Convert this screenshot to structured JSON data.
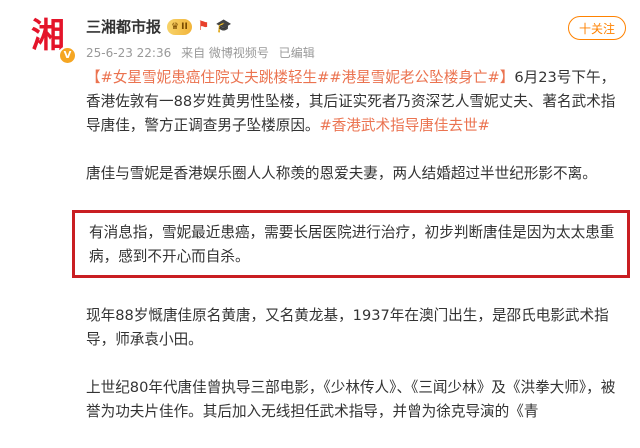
{
  "user": {
    "avatar_logo": "湘",
    "verified_icon": "v-verified-icon",
    "name": "三湘都市报",
    "vip_badge": "II",
    "badge_icons": [
      "flag-badge-icon",
      "graduation-cap-icon"
    ],
    "follow_label": "十关注"
  },
  "meta": {
    "timestamp": "25-6-23 22:36",
    "source": "来自 微博视频号",
    "edited": "已编辑"
  },
  "post": {
    "para1": {
      "tag1": "【#女星雪妮患癌住院丈夫跳楼轻生##港星雪妮老公坠楼身亡#】",
      "text1": "6月23号下午，香港佐敦有一88岁姓黄男性坠楼，其后证实死者乃资深艺人雪妮丈夫、著名武术指导唐佳，警方正调查男子坠楼原因。",
      "tag2": "#香港武术指导唐佳去世#"
    },
    "para2": "唐佳与雪妮是香港娱乐圈人人称羡的恩爱夫妻，两人结婚超过半世纪形影不离。",
    "para3": "有消息指，雪妮最近患癌，需要长居医院进行治疗，初步判断唐佳是因为太太患重病，感到不开心而自杀。",
    "para4": "现年88岁慨唐佳原名黄唐，又名黄龙基，1937年在澳门出生，是邵氏电影武术指导，师承袁小田。",
    "para5": "上世纪80年代唐佳曾执导三部电影，《少林传人》、《三闻少林》及《洪拳大师》，被誉为功夫片佳作。其后加入无线担任武术指导，并曾为徐克导演的《青"
  },
  "colors": {
    "accent": "#ff8200",
    "tag": "#eb7350",
    "highlight_border": "#c91e22",
    "brand_red": "#e4142a"
  }
}
